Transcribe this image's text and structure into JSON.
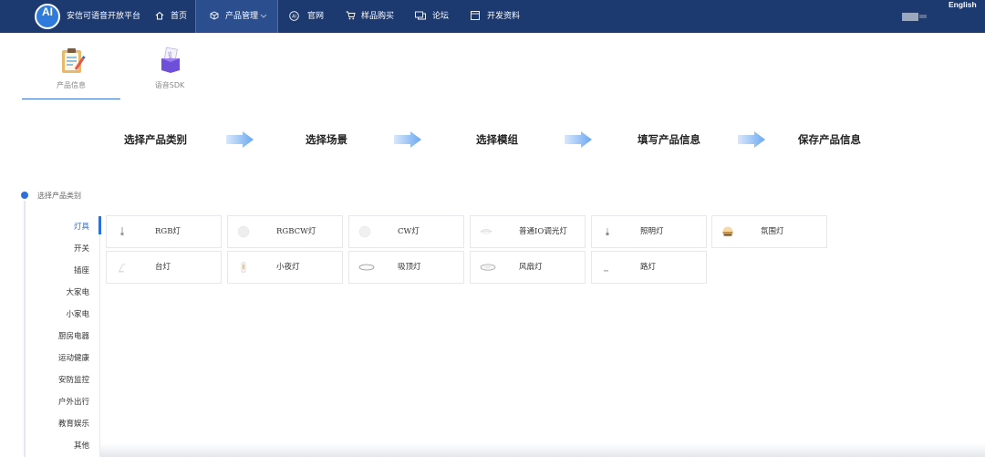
{
  "header": {
    "logo_text": "AI",
    "brand": "安信可语音开放平台",
    "nav": [
      {
        "label": "首页",
        "icon": "home-icon",
        "active": false
      },
      {
        "label": "产品管理",
        "icon": "cube-icon",
        "active": true
      },
      {
        "label": "官网",
        "icon": "ai-badge-icon",
        "active": false
      },
      {
        "label": "样品购买",
        "icon": "cart-icon",
        "active": false
      },
      {
        "label": "论坛",
        "icon": "chat-icon",
        "active": false
      },
      {
        "label": "开发资料",
        "icon": "doc-icon",
        "active": false
      }
    ],
    "language": "English"
  },
  "subtabs": [
    {
      "label": "产品信息",
      "icon": "clipboard-icon",
      "active": true
    },
    {
      "label": "语音SDK",
      "icon": "sdk-box-icon",
      "active": false
    }
  ],
  "steps": [
    "选择产品类别",
    "选择场景",
    "选择模组",
    "填写产品信息",
    "保存产品信息"
  ],
  "section_title": "选择产品类别",
  "categories": [
    {
      "label": "灯具",
      "active": true
    },
    {
      "label": "开关",
      "active": false
    },
    {
      "label": "插座",
      "active": false
    },
    {
      "label": "大家电",
      "active": false
    },
    {
      "label": "小家电",
      "active": false
    },
    {
      "label": "厨房电器",
      "active": false
    },
    {
      "label": "运动健康",
      "active": false
    },
    {
      "label": "安防监控",
      "active": false
    },
    {
      "label": "户外出行",
      "active": false
    },
    {
      "label": "教育娱乐",
      "active": false
    },
    {
      "label": "其他",
      "active": false
    }
  ],
  "products": [
    {
      "label": "RGB灯",
      "icon": "bulb-icon"
    },
    {
      "label": "RGBCW灯",
      "icon": "round-light-icon"
    },
    {
      "label": "CW灯",
      "icon": "round-light-icon"
    },
    {
      "label": "普通IO调光灯",
      "icon": "ceiling-lamp-icon"
    },
    {
      "label": "照明灯",
      "icon": "bulb-icon"
    },
    {
      "label": "氛围灯",
      "icon": "ambient-light-icon"
    },
    {
      "label": "台灯",
      "icon": "desk-lamp-icon"
    },
    {
      "label": "小夜灯",
      "icon": "night-light-icon"
    },
    {
      "label": "吸顶灯",
      "icon": "ceiling-light-icon"
    },
    {
      "label": "风扇灯",
      "icon": "fan-light-icon"
    },
    {
      "label": "路灯",
      "icon": "street-light-icon"
    }
  ],
  "colors": {
    "nav_bg": "#1d3a70",
    "accent": "#2f6fdc",
    "arrow": "#6aa8f0"
  }
}
